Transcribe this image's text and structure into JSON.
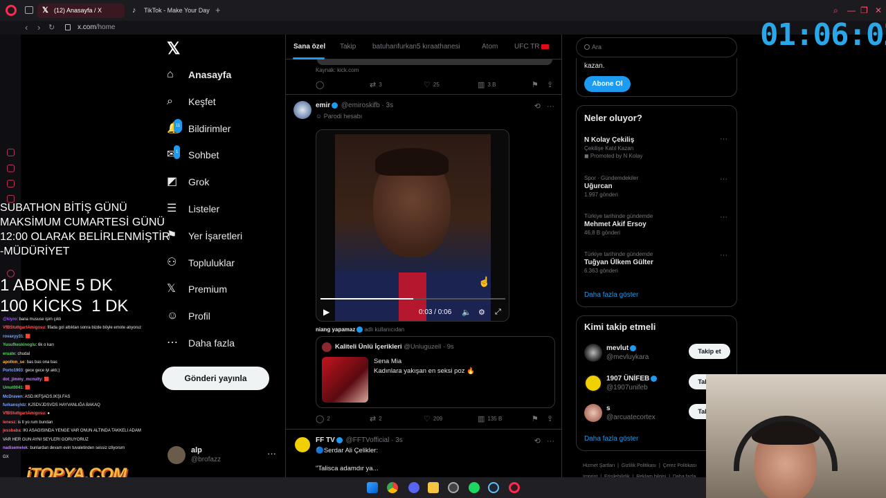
{
  "browser": {
    "tabs": [
      {
        "label": "(12) Anasayfa / X",
        "icon": "x-logo-icon",
        "active": true
      },
      {
        "label": "TikTok - Make Your Day",
        "icon": "tiktok-icon",
        "active": false
      }
    ],
    "new_tab": "+",
    "url_host": "x.com",
    "url_path": "/home"
  },
  "timer": "01:06:02",
  "nav": {
    "items": [
      {
        "label": "Anasayfa",
        "icon": "home-icon",
        "bold": true
      },
      {
        "label": "Keşfet",
        "icon": "search-icon"
      },
      {
        "label": "Bildirimler",
        "icon": "bell-icon",
        "badge": "11"
      },
      {
        "label": "Sohbet",
        "icon": "mail-icon",
        "badge": "1"
      },
      {
        "label": "Grok",
        "icon": "grok-icon"
      },
      {
        "label": "Listeler",
        "icon": "list-icon"
      },
      {
        "label": "Yer İşaretleri",
        "icon": "bookmark-icon"
      },
      {
        "label": "Topluluklar",
        "icon": "communities-icon"
      },
      {
        "label": "Premium",
        "icon": "x-premium-icon"
      },
      {
        "label": "Profil",
        "icon": "person-icon"
      },
      {
        "label": "Daha fazla",
        "icon": "more-circle-icon"
      }
    ],
    "post_button": "Gönderi yayınla",
    "account": {
      "name": "alp",
      "handle": "@brofazz",
      "more": "···"
    }
  },
  "overlay": {
    "notice": "SUBATHON BİTİŞ GÜNÜ\nMAKSİMUM CUMARTESİ GÜNÜ\n12:00 OLARAK BELİRLENMİŞTİR\n-MÜDÜRİYET",
    "rates": "1 ABONE 5 DK\n100 KİCKS  1 DK",
    "watermark": "iTOPYA.COM"
  },
  "chat": [
    {
      "user": "@kiyro",
      "text": ": bana mususe işim çıktı",
      "color": "#9b59ff"
    },
    {
      "user": "VfBStuttgartAmigosu",
      "text": ": fifada gol attıktan sonra bizde böyle emote atıyoruz",
      "color": "#ff5a5a"
    },
    {
      "user": "rovaxyy31",
      "text": ": 🟥",
      "color": "#7aa7ff"
    },
    {
      "user": "Yusufkeskinoglu",
      "text": ": 6k o karı",
      "color": "#56d364"
    },
    {
      "user": "eruate",
      "text": ": chudal",
      "color": "#56d364"
    },
    {
      "user": "apollon_se",
      "text": ": bas bas ona bas",
      "color": "#ffb84d"
    },
    {
      "user": "Porto1903",
      "text": ": gece gece iyi aktı;)",
      "color": "#7aa7ff"
    },
    {
      "user": "dot_jimmy_mcnulty",
      "text": ": 🟥",
      "color": "#c084fc"
    },
    {
      "user": "Umut0041",
      "text": ": 🟥",
      "color": "#56d364"
    },
    {
      "user": "McDraven",
      "text": ": ASD.IKFŞADS.IKŞI.FAS",
      "color": "#7aa7ff"
    },
    {
      "user": "furkansyldz",
      "text": ": KJSDVJDSVDS HAYVANLIĞA BAKAQ",
      "color": "#7aa7ff"
    },
    {
      "user": "VfBStuttgartAmigosu",
      "text": ": ●",
      "color": "#ff5a5a"
    },
    {
      "user": "lenesz",
      "text": ": is tl yo rum bundan",
      "color": "#ff5a5a"
    },
    {
      "user": "jessbaba",
      "text": ": IKI ASAGISINDA YENGE VAR ONUN ALTINDA TAKKELI ADAM",
      "color": "#ff5a5a"
    },
    {
      "user": "",
      "text": "VAR HER GUN AYNI SEYLERI GORUYORUZ",
      "color": "#ffffff"
    },
    {
      "user": "nadisemelek",
      "text": ": bunlardan devam evin tuvaletinden sessiz izliyorum",
      "color": "#c084fc"
    },
    {
      "user": "",
      "text": "GX",
      "color": "#ff5a5a"
    }
  ],
  "timeline": {
    "tabs": [
      "Sana özel",
      "Takip",
      "batuhanfurkan5 kıraathanesi",
      "Atom",
      "UFC TR"
    ],
    "prev_post": {
      "source": "Kaynak: kick.com",
      "replies": "",
      "reposts": "3",
      "likes": "25",
      "views": "3 B"
    },
    "post1": {
      "name": "emir",
      "handle": "@emiroskifb",
      "time": "3s",
      "label": "Parodi hesabı",
      "video_time": "0:03 / 0:06",
      "video_progress": 0.5,
      "quote_label_user": "niang yapamaz",
      "quote_label_suffix": "adlı kullanıcıdan",
      "quote": {
        "name": "Kaliteli Ünlü İçerikleri",
        "handle": "@Unluguzell",
        "time": "9s",
        "author": "Sena Mia",
        "text": "Kadınlara yakışan en seksi poz 🔥"
      },
      "replies": "2",
      "reposts": "2",
      "likes": "209",
      "views": "135 B"
    },
    "post2": {
      "name": "FF TV",
      "handle": "@FFTVofficial",
      "time": "3s",
      "line1": "Serdar Ali Çelikler:",
      "line2": "\"Talisca adamdır ya..."
    }
  },
  "right": {
    "search_placeholder": "Ara",
    "subscribe": {
      "text": "kazan.",
      "button": "Abone Ol"
    },
    "trends_title": "Neler oluyor?",
    "trends": [
      {
        "context": "",
        "name": "N Kolay Çekiliş",
        "count": "Çekilişe Katıl Kazan",
        "extra": "Promoted by N Kolay"
      },
      {
        "context": "Spor · Gündemdekiler",
        "name": "Uğurcan",
        "count": "1.997 gönderi"
      },
      {
        "context": "Türkiye tarihinde gündemde",
        "name": "Mehmet Akif Ersoy",
        "count": "46,8 B gönderi"
      },
      {
        "context": "Türkiye tarihinde gündemde",
        "name": "Tuğyan Ülkem Gülter",
        "count": "6.363 gönderi"
      }
    ],
    "show_more": "Daha fazla göster",
    "who_title": "Kimi takip etmeli",
    "who": [
      {
        "name": "mevlut",
        "handle": "@mevluykara",
        "button": "Takip et"
      },
      {
        "name": "1907 ÜNİFEB",
        "handle": "@1907unifeb",
        "button": "Takip et"
      },
      {
        "name": "s",
        "handle": "@arcuatecortex",
        "button": "Takip et"
      }
    ],
    "footer": [
      "Hizmet Şartları",
      "Gizlilik Politikası",
      "Çerez Politikası",
      "Imprint",
      "Erişilebilirlik",
      "Reklam bilgisi",
      "Daha fazla"
    ]
  },
  "colors": {
    "accent": "#1d9bf0",
    "brand": "#ff2a4f",
    "timer": "#2aa7e8"
  }
}
